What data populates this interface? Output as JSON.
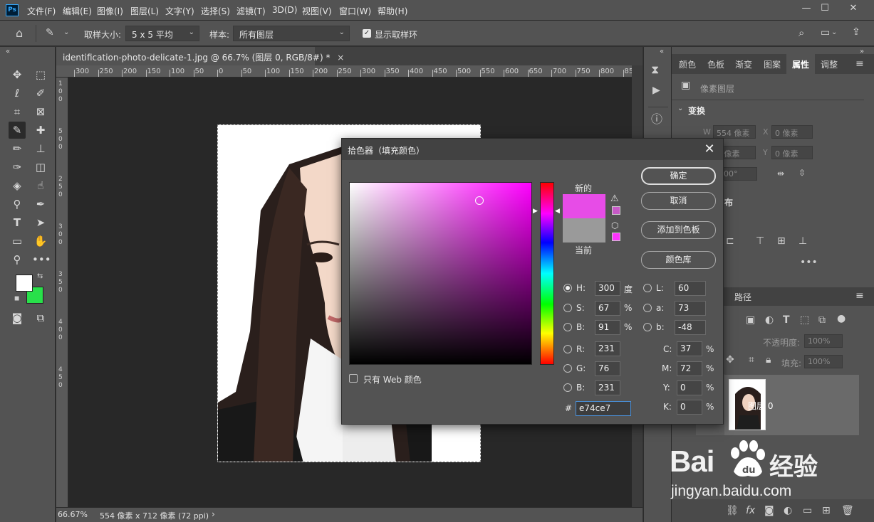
{
  "app": {
    "logo": "Ps"
  },
  "menu": [
    "文件(F)",
    "编辑(E)",
    "图像(I)",
    "图层(L)",
    "文字(Y)",
    "选择(S)",
    "滤镜(T)",
    "3D(D)",
    "视图(V)",
    "窗口(W)",
    "帮助(H)"
  ],
  "window_controls": {
    "minimize": "—",
    "maximize": "☐",
    "close": "✕"
  },
  "options": {
    "sample_size_label": "取样大小:",
    "sample_size_value": "5 x 5 平均",
    "sample_label": "样本:",
    "sample_value": "所有图层",
    "show_ring_label": "显示取样环"
  },
  "document": {
    "tab_title": "identification-photo-delicate-1.jpg @ 66.7% (图层 0, RGB/8#) *",
    "close": "×"
  },
  "ruler": {
    "h_ticks": [
      "300",
      "250",
      "200",
      "150",
      "100",
      "50",
      "0",
      "50",
      "100",
      "150",
      "200",
      "250",
      "300",
      "350",
      "400",
      "450",
      "500",
      "550",
      "600",
      "650",
      "700",
      "750",
      "800",
      "85"
    ],
    "v_ticks": [
      "1",
      "0",
      "0",
      "5",
      "0",
      "0",
      "2",
      "5",
      "0",
      "3",
      "0",
      "0",
      "3",
      "5",
      "0",
      "4",
      "0",
      "0",
      "4",
      "5",
      "0"
    ]
  },
  "status": {
    "zoom": "66.67%",
    "info": "554 像素 x 712 像素 (72 ppi)"
  },
  "panel_tabs": [
    "颜色",
    "色板",
    "渐变",
    "图案",
    "属性",
    "调整"
  ],
  "properties": {
    "type_label": "像素图层",
    "transform_label": "变换",
    "w_label": "W",
    "w_value": "554 像素",
    "x_label": "X",
    "x_value": "0 像素",
    "h_value": "9 像素",
    "y_label": "Y",
    "y_value": "0 像素",
    "angle_value": "00°",
    "distribute_label": "布"
  },
  "layers": {
    "tab_paths": "路径",
    "opacity_label": "不透明度:",
    "opacity_value": "100%",
    "fill_label": "填充:",
    "fill_value": "100%",
    "layer_name": "图层 0"
  },
  "dialog": {
    "title": "拾色器（填充颜色）",
    "close": "✕",
    "ok": "确定",
    "cancel": "取消",
    "add_swatch": "添加到色板",
    "color_library": "颜色库",
    "new_label": "新的",
    "current_label": "当前",
    "new_color": "#e74ce7",
    "current_color": "#9a9a9a",
    "web_only_label": "只有 Web 颜色",
    "fields_left": [
      {
        "label": "H:",
        "value": "300",
        "unit": "度"
      },
      {
        "label": "S:",
        "value": "67",
        "unit": "%"
      },
      {
        "label": "B:",
        "value": "91",
        "unit": "%"
      },
      {
        "label": "R:",
        "value": "231",
        "unit": ""
      },
      {
        "label": "G:",
        "value": "76",
        "unit": ""
      },
      {
        "label": "B:",
        "value": "231",
        "unit": ""
      }
    ],
    "fields_lab": [
      {
        "label": "L:",
        "value": "60"
      },
      {
        "label": "a:",
        "value": "73"
      },
      {
        "label": "b:",
        "value": "-48"
      }
    ],
    "fields_cmyk": [
      {
        "label": "C:",
        "value": "37",
        "unit": "%"
      },
      {
        "label": "M:",
        "value": "72",
        "unit": "%"
      },
      {
        "label": "Y:",
        "value": "0",
        "unit": "%"
      },
      {
        "label": "K:",
        "value": "0",
        "unit": "%"
      }
    ],
    "hex_label": "#",
    "hex_value": "e74ce7"
  },
  "watermark": {
    "brand": "Bai",
    "brand_cn": "经验",
    "url": "jingyan.baidu.com"
  },
  "colors": {
    "foreground": "#ffffff",
    "background": "#28e04a",
    "accent": "#31a8ff"
  }
}
